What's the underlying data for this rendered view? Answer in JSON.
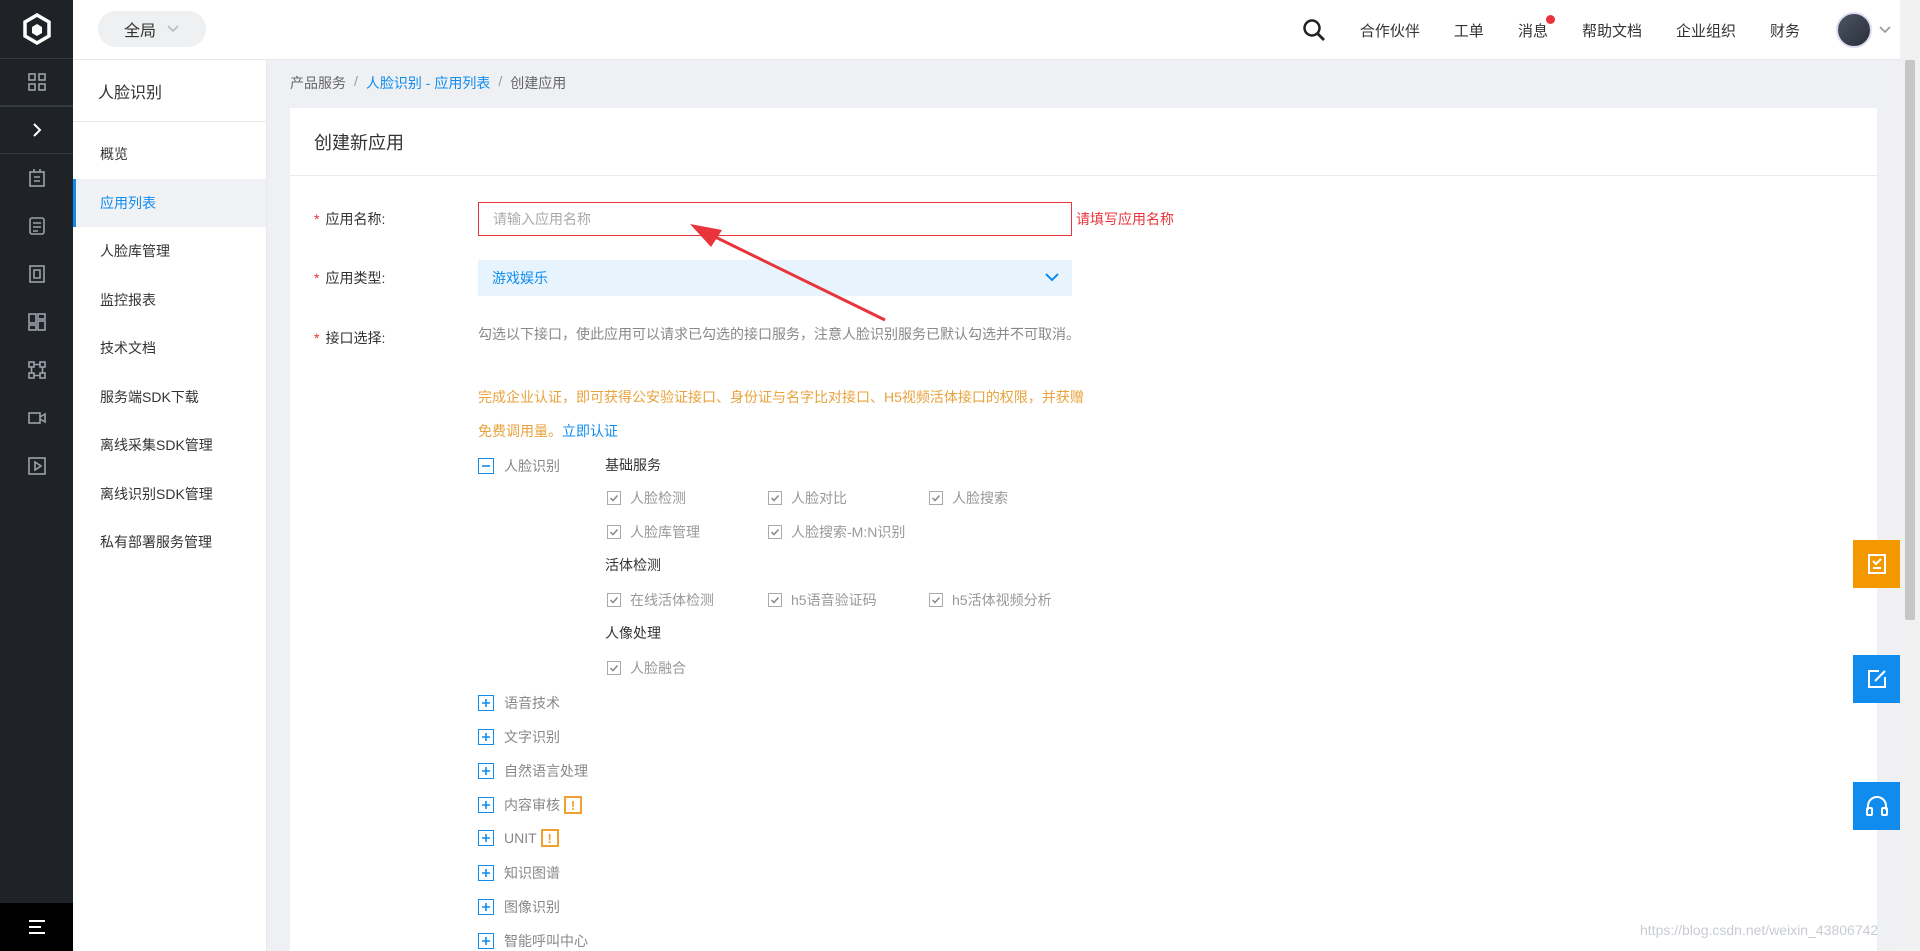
{
  "topbar": {
    "scope_label": "全局",
    "nav": [
      "合作伙伴",
      "工单",
      "消息",
      "帮助文档",
      "企业组织",
      "财务"
    ]
  },
  "sidebar": {
    "title": "人脸识别",
    "items": [
      "概览",
      "应用列表",
      "人脸库管理",
      "监控报表",
      "技术文档",
      "服务端SDK下载",
      "离线采集SDK管理",
      "离线识别SDK管理",
      "私有部署服务管理"
    ],
    "active_index": 1
  },
  "breadcrumb": {
    "root": "产品服务",
    "sep": "/",
    "list": "人脸识别 - 应用列表",
    "current": "创建应用"
  },
  "form": {
    "title": "创建新应用",
    "required_mark": "*",
    "name_label": "应用名称:",
    "name_placeholder": "请输入应用名称",
    "name_error": "请填写应用名称",
    "type_label": "应用类型:",
    "type_value": "游戏娱乐",
    "api_label": "接口选择:",
    "api_desc": "勾选以下接口，使此应用可以请求已勾选的接口服务，注意人脸识别服务已默认勾选并不可取消。",
    "api_warn": "完成企业认证，即可获得公安验证接口、身份证与名字比对接口、H5视频活体接口的权限，并获赠免费调用量。",
    "api_auth_link": "立即认证"
  },
  "face_category": {
    "label": "人脸识别",
    "groups": [
      {
        "name": "基础服务",
        "options": [
          "人脸检测",
          "人脸对比",
          "人脸搜索",
          "人脸库管理",
          "人脸搜索-M:N识别"
        ]
      },
      {
        "name": "活体检测",
        "options": [
          "在线活体检测",
          "h5语音验证码",
          "h5活体视频分析"
        ]
      },
      {
        "name": "人像处理",
        "options": [
          "人脸融合"
        ]
      }
    ]
  },
  "categories": [
    {
      "label": "语音技术",
      "warn": false
    },
    {
      "label": "文字识别",
      "warn": false
    },
    {
      "label": "自然语言处理",
      "warn": false
    },
    {
      "label": "内容审核",
      "warn": true
    },
    {
      "label": "UNIT",
      "warn": true
    },
    {
      "label": "知识图谱",
      "warn": false
    },
    {
      "label": "图像识别",
      "warn": false
    },
    {
      "label": "智能呼叫中心",
      "warn": false
    }
  ],
  "warn_glyph": "!",
  "watermark": "https://blog.csdn.net/weixin_43806742",
  "colors": {
    "accent": "#108cee",
    "error": "#e8343a",
    "warning": "#e8a33c",
    "floating": "#f39800"
  }
}
